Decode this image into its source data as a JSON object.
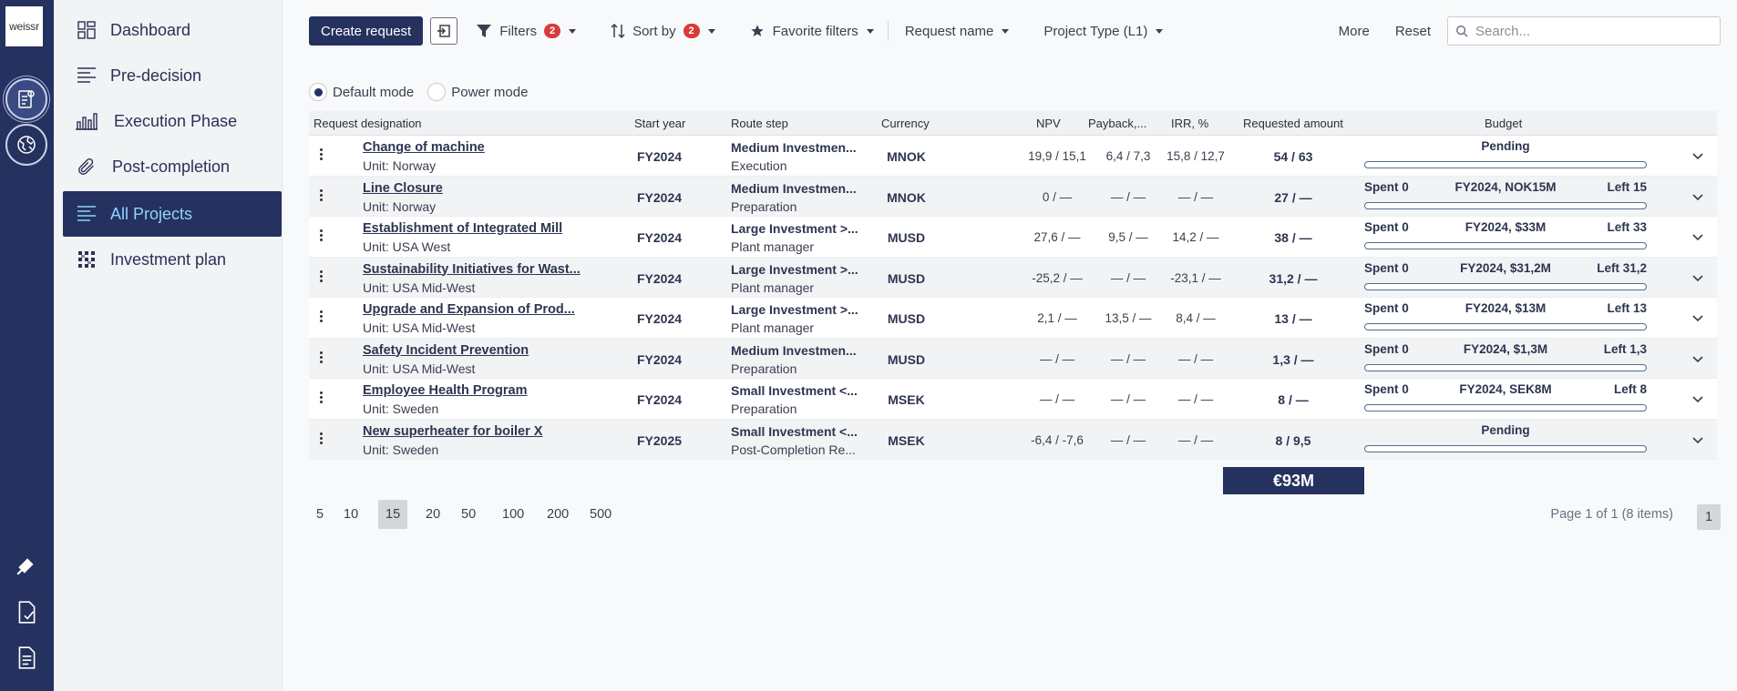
{
  "logo": "weissr",
  "nav": [
    {
      "label": "Dashboard",
      "icon": "dashboard-icon"
    },
    {
      "label": "Pre-decision",
      "icon": "lines-icon"
    },
    {
      "label": "Execution Phase",
      "icon": "bar-chart-icon"
    },
    {
      "label": "Post-completion",
      "icon": "paperclip-icon"
    },
    {
      "label": "All Projects",
      "icon": "lines-icon",
      "active": true
    },
    {
      "label": "Investment plan",
      "icon": "grid-icon"
    }
  ],
  "toolbar": {
    "create": "Create request",
    "filters": "Filters",
    "filters_count": "2",
    "sort": "Sort by",
    "sort_count": "2",
    "favorite": "Favorite filters",
    "request_name": "Request name",
    "project_type": "Project Type (L1)",
    "more": "More",
    "reset": "Reset",
    "search_placeholder": "Search..."
  },
  "modes": {
    "default": "Default mode",
    "power": "Power mode",
    "selected": "default"
  },
  "columns": {
    "designation": "Request designation",
    "year": "Start year",
    "route": "Route step",
    "currency": "Currency",
    "npv": "NPV",
    "payback": "Payback,...",
    "irr": "IRR, %",
    "requested": "Requested amount",
    "budget": "Budget"
  },
  "rows": [
    {
      "name": "Change of machine",
      "unit": "Unit: Norway",
      "year": "FY2024",
      "route1": "Medium Investmen...",
      "route2": "Execution",
      "currency": "MNOK",
      "npv": "19,9 / 15,1",
      "payback": "6,4 / 7,3",
      "irr": "15,8 / 12,7",
      "requested": "54 / 63",
      "budget": {
        "pending": "Pending"
      }
    },
    {
      "name": "Line Closure",
      "unit": "Unit: Norway",
      "year": "FY2024",
      "route1": "Medium Investmen...",
      "route2": "Preparation",
      "currency": "MNOK",
      "npv": "0 / —",
      "payback": "— / —",
      "irr": "— / —",
      "requested": "27 / —",
      "budget": {
        "spent": "Spent 0",
        "plan": "FY2024, NOK15M",
        "left": "Left 15"
      }
    },
    {
      "name": "Establishment of Integrated Mill",
      "unit": "Unit: USA West",
      "year": "FY2024",
      "route1": "Large Investment >...",
      "route2": "Plant manager",
      "currency": "MUSD",
      "npv": "27,6 / —",
      "payback": "9,5 / —",
      "irr": "14,2 / —",
      "requested": "38 / —",
      "budget": {
        "spent": "Spent 0",
        "plan": "FY2024, $33M",
        "left": "Left 33"
      }
    },
    {
      "name": "Sustainability Initiatives for Wast...",
      "unit": "Unit: USA Mid-West",
      "year": "FY2024",
      "route1": "Large Investment >...",
      "route2": "Plant manager",
      "currency": "MUSD",
      "npv": "-25,2 / —",
      "payback": "— / —",
      "irr": "-23,1 / —",
      "requested": "31,2 / —",
      "budget": {
        "spent": "Spent 0",
        "plan": "FY2024, $31,2M",
        "left": "Left 31,2"
      }
    },
    {
      "name": "Upgrade and Expansion of Prod...",
      "unit": "Unit: USA Mid-West",
      "year": "FY2024",
      "route1": "Large Investment >...",
      "route2": "Plant manager",
      "currency": "MUSD",
      "npv": "2,1 / —",
      "payback": "13,5 / —",
      "irr": "8,4 / —",
      "requested": "13 / —",
      "budget": {
        "spent": "Spent 0",
        "plan": "FY2024, $13M",
        "left": "Left 13"
      }
    },
    {
      "name": "Safety Incident Prevention",
      "unit": "Unit: USA Mid-West",
      "year": "FY2024",
      "route1": "Medium Investmen...",
      "route2": "Preparation",
      "currency": "MUSD",
      "npv": "— / —",
      "payback": "— / —",
      "irr": "— / —",
      "requested": "1,3 / —",
      "budget": {
        "spent": "Spent 0",
        "plan": "FY2024, $1,3M",
        "left": "Left 1,3"
      }
    },
    {
      "name": "Employee Health Program",
      "unit": "Unit: Sweden",
      "year": "FY2024",
      "route1": "Small Investment <...",
      "route2": "Preparation",
      "currency": "MSEK",
      "npv": "— / —",
      "payback": "— / —",
      "irr": "— / —",
      "requested": "8 / —",
      "budget": {
        "spent": "Spent 0",
        "plan": "FY2024, SEK8M",
        "left": "Left 8"
      }
    },
    {
      "name": "New superheater for boiler X",
      "unit": "Unit: Sweden",
      "year": "FY2025",
      "route1": "Small Investment <...",
      "route2": "Post-Completion Re...",
      "currency": "MSEK",
      "npv": "-6,4 / -7,6",
      "payback": "— / —",
      "irr": "— / —",
      "requested": "8 / 9,5",
      "budget": {
        "pending": "Pending"
      }
    }
  ],
  "total": "€93M",
  "pager": {
    "sizes": [
      "5",
      "10",
      "15",
      "20",
      "50",
      "100",
      "200",
      "500"
    ],
    "selected": "15",
    "info": "Page 1 of 1 (8 items)",
    "page": "1"
  },
  "colors": {
    "navy": "#25315e",
    "active_text": "#8fd3ff",
    "badge": "#d93a3a"
  }
}
